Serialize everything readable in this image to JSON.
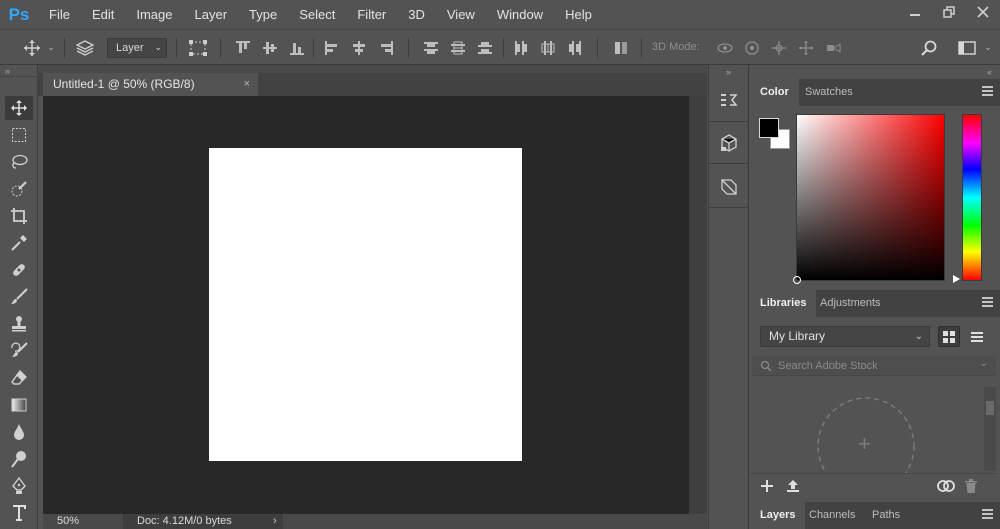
{
  "app": {
    "logo": "Ps"
  },
  "menu": [
    "File",
    "Edit",
    "Image",
    "Layer",
    "Type",
    "Select",
    "Filter",
    "3D",
    "View",
    "Window",
    "Help"
  ],
  "window_controls": [
    "minimize-icon",
    "restore-icon",
    "close-icon"
  ],
  "options_bar": {
    "auto_select_target": "Layer",
    "mode_3d_label": "3D Mode:",
    "align_icons": [
      "align-top-icon",
      "align-vcenter-icon",
      "align-bottom-icon",
      "align-left-icon",
      "align-hcenter-icon",
      "align-right-icon"
    ],
    "distribute_icons": [
      "dist-top-icon",
      "dist-vcenter-icon",
      "dist-bottom-icon",
      "dist-left-icon",
      "dist-hcenter-icon",
      "dist-right-icon"
    ]
  },
  "tools": [
    "move-tool",
    "marquee-tool",
    "lasso-tool",
    "quick-select-tool",
    "crop-tool",
    "eyedropper-tool",
    "healing-brush-tool",
    "brush-tool",
    "clone-stamp-tool",
    "history-brush-tool",
    "eraser-tool",
    "gradient-tool",
    "blur-tool",
    "dodge-tool",
    "pen-tool",
    "type-tool"
  ],
  "document": {
    "tab_label": "Untitled-1 @ 50% (RGB/8)",
    "close_glyph": "×",
    "zoom": "50%",
    "doc_info": "Doc: 4.12M/0 bytes",
    "status_arrow": "›",
    "canvas_color": "#ffffff"
  },
  "color_panel": {
    "tabs": [
      "Color",
      "Swatches"
    ],
    "foreground": "#000000",
    "background": "#ffffff",
    "hue": "#ff0000"
  },
  "libraries_panel": {
    "tabs": [
      "Libraries",
      "Adjustments"
    ],
    "selected_library": "My Library",
    "search_placeholder": "Search Adobe Stock",
    "add_glyph": "+"
  },
  "layers_panel": {
    "tabs": [
      "Layers",
      "Channels",
      "Paths"
    ]
  },
  "collapse_glyph": "»",
  "expand_glyph": "«"
}
